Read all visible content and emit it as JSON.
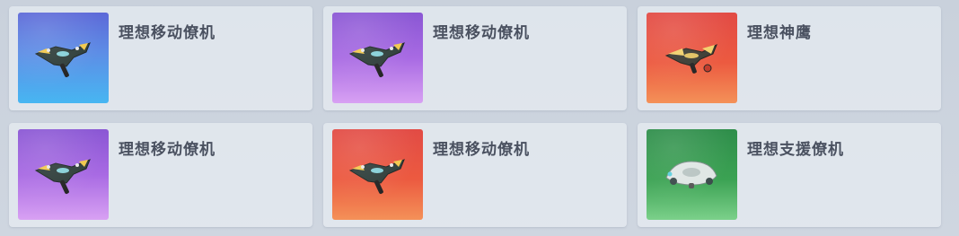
{
  "items": [
    {
      "name": "理想移动僚机",
      "rarity_color": "blue",
      "icon": "mobile-wingman-drone-icon"
    },
    {
      "name": "理想移动僚机",
      "rarity_color": "purple",
      "icon": "mobile-wingman-drone-icon"
    },
    {
      "name": "理想神鹰",
      "rarity_color": "red",
      "icon": "divine-eagle-drone-icon"
    },
    {
      "name": "理想移动僚机",
      "rarity_color": "purple",
      "icon": "mobile-wingman-drone-icon"
    },
    {
      "name": "理想移动僚机",
      "rarity_color": "red",
      "icon": "mobile-wingman-drone-icon"
    },
    {
      "name": "理想支援僚机",
      "rarity_color": "green",
      "icon": "support-wingman-drone-icon"
    }
  ]
}
